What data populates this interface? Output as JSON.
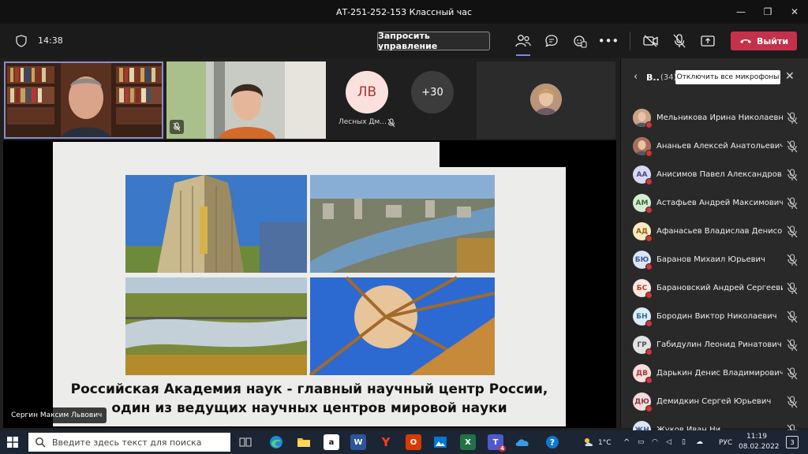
{
  "window": {
    "title": "АТ-251-252-153 Классный час",
    "minimize": "—",
    "maximize": "❐",
    "close": "✕"
  },
  "toolbar": {
    "timer": "14:38",
    "request_control_label": "Запросить управление",
    "more_label": "•••",
    "leave_label": "Выйти"
  },
  "tiles": {
    "lv_initials": "ЛВ",
    "lv_name": "Лесных Дм...",
    "overflow_count": "+30"
  },
  "slide": {
    "line1": "Российская Академия наук - главный научный центр России,",
    "line2": "один из ведущих научных центров мировой науки",
    "presenter_name": "Сергин Максим Львович"
  },
  "panel": {
    "title": "В..",
    "count": "(34)",
    "tooltip": "Отключить все микрофоны",
    "participants": [
      {
        "initials": "",
        "name": "Мельникова Ирина Николаевна",
        "bg": "#c9a38a",
        "fg": "#5a3a2a",
        "photo": true
      },
      {
        "initials": "",
        "name": "Ананьев Алексей Анатольевич",
        "bg": "#a8705a",
        "fg": "#fff",
        "photo": true
      },
      {
        "initials": "АА",
        "name": "Анисимов Павел Александров...",
        "bg": "#d9d9f3",
        "fg": "#4a4a8a"
      },
      {
        "initials": "АМ",
        "name": "Астафьев Андрей Максимович",
        "bg": "#d6ecd2",
        "fg": "#3a6b34"
      },
      {
        "initials": "АД",
        "name": "Афанасьев Владислав Денисов...",
        "bg": "#fbeac4",
        "fg": "#8a6513"
      },
      {
        "initials": "БЮ",
        "name": "Баранов Михаил Юрьевич",
        "bg": "#dde6f6",
        "fg": "#3b5c96"
      },
      {
        "initials": "БС",
        "name": "Барановский Андрей Сергеевич",
        "bg": "#fde7e1",
        "fg": "#a7452e"
      },
      {
        "initials": "БН",
        "name": "Бородин Виктор Николаевич",
        "bg": "#dcecf7",
        "fg": "#2e6b96"
      },
      {
        "initials": "ГР",
        "name": "Габидулин Леонид Ринатович",
        "bg": "#e2e2e2",
        "fg": "#555"
      },
      {
        "initials": "ДВ",
        "name": "Дарькин Денис Владимирович",
        "bg": "#fbdedd",
        "fg": "#a7372e"
      },
      {
        "initials": "ДЮ",
        "name": "Демидкин Сергей Юрьевич",
        "bg": "#f3dcdc",
        "fg": "#8a3a3a"
      },
      {
        "initials": "ЖН",
        "name": "Жуков Иван Ни...",
        "bg": "#dde6f6",
        "fg": "#3b5c96"
      }
    ]
  },
  "taskbar": {
    "search_placeholder": "Введите здесь текст для поиска",
    "teams_badge": "4",
    "weather": "1°C",
    "lang": "РУС",
    "time": "11:19",
    "date": "08.02.2022",
    "notif_count": "3",
    "apps": {
      "word": "W",
      "excel": "X",
      "office": "O",
      "yandex": "Y",
      "amazon": "a"
    }
  }
}
